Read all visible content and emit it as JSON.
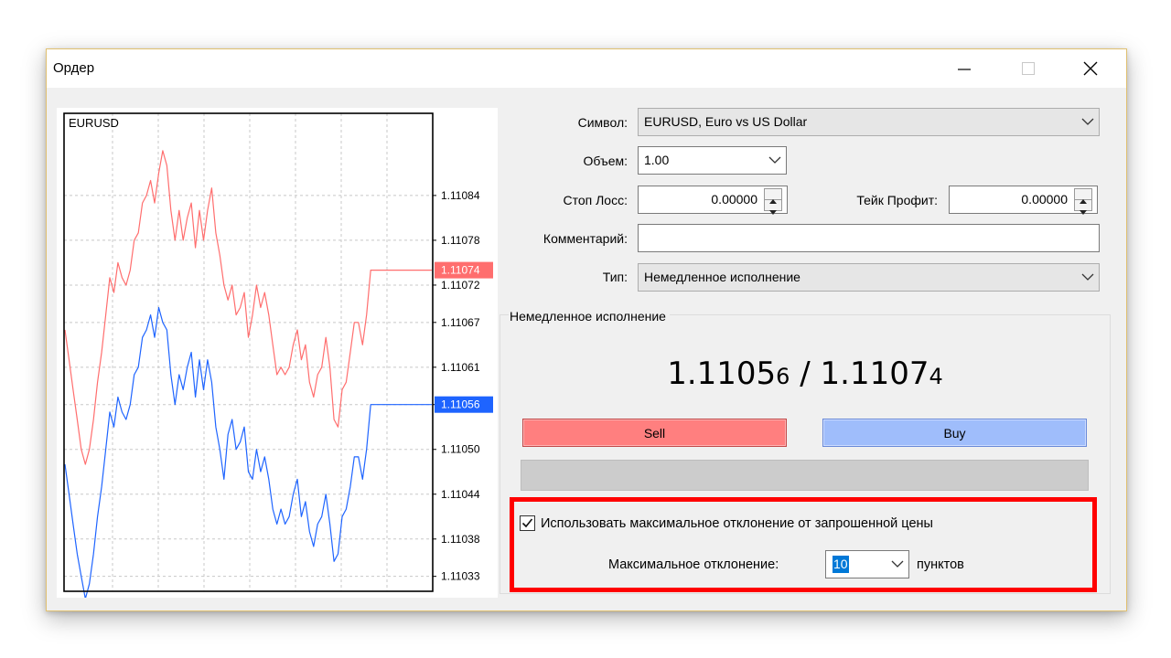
{
  "window": {
    "title": "Ордер"
  },
  "chart": {
    "symbol": "EURUSD",
    "y_ticks": [
      "1.11084",
      "1.11078",
      "1.11072",
      "1.11067",
      "1.11061",
      "1.11056",
      "1.11050",
      "1.11044",
      "1.11038",
      "1.11033"
    ],
    "ask_label": "1.11074",
    "bid_label": "1.11056",
    "ask_color": "#ff6e6e",
    "bid_color": "#1e64ff",
    "ask_series": [
      1.11066,
      1.11062,
      1.11058,
      1.11054,
      1.1105,
      1.11048,
      1.1105,
      1.11054,
      1.11059,
      1.11063,
      1.11068,
      1.11073,
      1.11071,
      1.11075,
      1.11073,
      1.11072,
      1.11074,
      1.11078,
      1.11079,
      1.11083,
      1.11084,
      1.11086,
      1.11083,
      1.11087,
      1.1109,
      1.11088,
      1.11082,
      1.11078,
      1.11082,
      1.11078,
      1.11081,
      1.11083,
      1.11077,
      1.11082,
      1.11078,
      1.11082,
      1.11085,
      1.11079,
      1.11076,
      1.11072,
      1.1107,
      1.11072,
      1.11068,
      1.11069,
      1.11071,
      1.11065,
      1.11068,
      1.11072,
      1.11069,
      1.11071,
      1.11068,
      1.11064,
      1.1106,
      1.11061,
      1.1106,
      1.11061,
      1.11064,
      1.11066,
      1.11062,
      1.11064,
      1.11059,
      1.11057,
      1.1106,
      1.11061,
      1.11065,
      1.11061,
      1.11054,
      1.11053,
      1.11058,
      1.11059,
      1.11063,
      1.11067,
      1.11067,
      1.11064,
      1.11068,
      1.11074,
      1.11074,
      1.11074,
      1.11074,
      1.11074,
      1.11074,
      1.11074,
      1.11074,
      1.11074,
      1.11074,
      1.11074,
      1.11074,
      1.11074,
      1.11074,
      1.11074,
      1.11074
    ],
    "bid_series": [
      1.11048,
      1.11044,
      1.1104,
      1.11036,
      1.11033,
      1.1103,
      1.11032,
      1.11036,
      1.11041,
      1.11045,
      1.1105,
      1.11055,
      1.11053,
      1.11057,
      1.11055,
      1.11054,
      1.11056,
      1.1106,
      1.11061,
      1.11065,
      1.11066,
      1.11068,
      1.11065,
      1.11069,
      1.11067,
      1.11066,
      1.1106,
      1.11056,
      1.1106,
      1.11058,
      1.11061,
      1.11063,
      1.11057,
      1.11062,
      1.11058,
      1.11062,
      1.11059,
      1.11053,
      1.1105,
      1.11046,
      1.11052,
      1.11054,
      1.1105,
      1.11051,
      1.11053,
      1.11047,
      1.11046,
      1.1105,
      1.11047,
      1.11049,
      1.11046,
      1.11042,
      1.1104,
      1.11042,
      1.1104,
      1.11041,
      1.11044,
      1.11046,
      1.11041,
      1.11043,
      1.11039,
      1.11037,
      1.1104,
      1.11041,
      1.11044,
      1.1104,
      1.11035,
      1.11036,
      1.11041,
      1.11042,
      1.11045,
      1.11049,
      1.11049,
      1.11046,
      1.1105,
      1.11056,
      1.11056,
      1.11056,
      1.11056,
      1.11056,
      1.11056,
      1.11056,
      1.11056,
      1.11056,
      1.11056,
      1.11056,
      1.11056,
      1.11056,
      1.11056,
      1.11056,
      1.11056
    ],
    "y_min": 1.11031,
    "y_max": 1.11095
  },
  "form": {
    "symbol_label": "Символ:",
    "symbol_value": "EURUSD, Euro vs US Dollar",
    "volume_label": "Объем:",
    "volume_value": "1.00",
    "sl_label": "Стоп Лосс:",
    "sl_value": "0.00000",
    "tp_label": "Тейк Профит:",
    "tp_value": "0.00000",
    "comment_label": "Комментарий:",
    "comment_value": "",
    "type_label": "Тип:",
    "type_value": "Немедленное исполнение"
  },
  "execution": {
    "group_label": "Немедленное исполнение",
    "bid_main": "1.1105",
    "bid_last": "6",
    "separator": " / ",
    "ask_main": "1.1107",
    "ask_last": "4",
    "sell_label": "Sell",
    "buy_label": "Buy",
    "sell_color": "#ff7f7f",
    "buy_color": "#9fbdfb",
    "deviation_checkbox_label": "Использовать максимальное отклонение от запрошенной цены",
    "deviation_checked": true,
    "deviation_label": "Максимальное отклонение:",
    "deviation_value": "10",
    "deviation_units": "пунктов",
    "highlight_color": "#ff0000"
  }
}
